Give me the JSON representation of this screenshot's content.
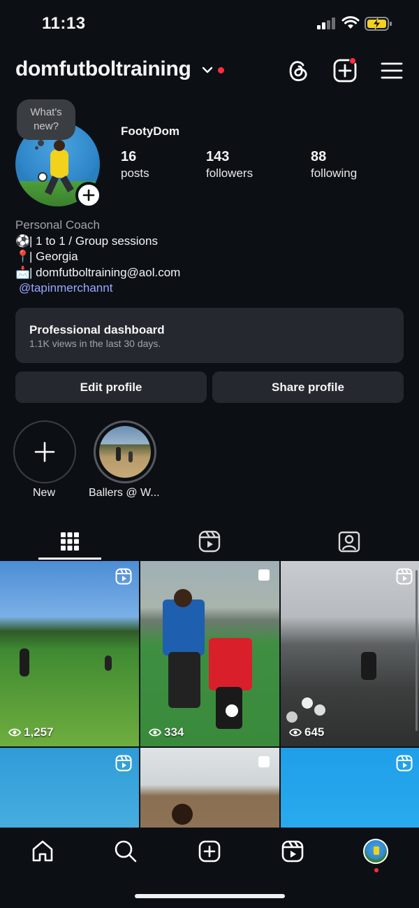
{
  "status_bar": {
    "time": "11:13"
  },
  "header": {
    "username": "domfutboltraining"
  },
  "profile": {
    "note_bubble": "What's new?",
    "full_name": "FootyDom",
    "stats": [
      {
        "value": "16",
        "label": "posts"
      },
      {
        "value": "143",
        "label": "followers"
      },
      {
        "value": "88",
        "label": "following"
      }
    ],
    "bio": {
      "category": "Personal Coach",
      "line1_emoji": "⚽️",
      "line1": "| 1 to 1 / Group sessions",
      "line2_emoji": "📍",
      "line2": "| Georgia",
      "line3_emoji": "📩",
      "line3": "| domfutboltraining@aol.com",
      "mention": "@tapinmerchannt"
    }
  },
  "dashboard": {
    "title": "Professional dashboard",
    "subtitle": "1.1K views in the last 30 days."
  },
  "buttons": {
    "edit_profile": "Edit profile",
    "share_profile": "Share profile"
  },
  "highlights": [
    {
      "label": "New"
    },
    {
      "label": "Ballers @ W..."
    }
  ],
  "tabs": [
    "grid",
    "reels",
    "tagged"
  ],
  "posts": [
    {
      "type": "reel",
      "views": "1,257"
    },
    {
      "type": "carousel",
      "views": "334"
    },
    {
      "type": "reel",
      "views": "645"
    },
    {
      "type": "reel",
      "views": ""
    },
    {
      "type": "carousel",
      "views": ""
    },
    {
      "type": "reel",
      "views": ""
    }
  ],
  "colors": {
    "background": "#0c1015",
    "surface": "#25292f",
    "notification": "#ff2d40",
    "link": "#9aa8ff",
    "battery": "#f5d020"
  },
  "icons": {
    "header": [
      "threads-icon",
      "new-post-icon",
      "menu-icon"
    ],
    "bottom_nav": [
      "home-icon",
      "search-icon",
      "create-icon",
      "reels-icon",
      "profile-avatar"
    ]
  }
}
